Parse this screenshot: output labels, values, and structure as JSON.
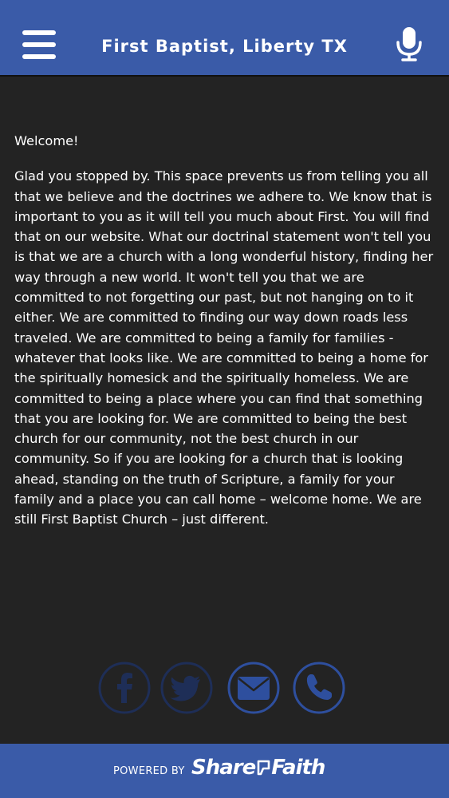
{
  "header": {
    "title": "First Baptist, Liberty TX",
    "menu_icon": "hamburger-menu-icon",
    "mic_icon": "microphone-icon"
  },
  "content": {
    "greeting": "Welcome!",
    "body": "Glad you stopped by. This space prevents us from telling you all that we believe and the doctrines we adhere to.  We know that is important to you as it will tell you much about First. You will find that on our website. What our doctrinal statement won't tell you is that we are a church with a long wonderful history, finding her way through a new world.  It won't tell you that we are committed to not forgetting our past, but not hanging on to it either. We are committed to finding our way down roads less traveled. We are committed to being a family for families - whatever that looks like. We are committed to being a home for the spiritually homesick and the spiritually homeless. We are committed to being a place where you can find that something that you are looking for. We are committed to being the best church for our community, not the best church in our community. So if you are looking for a church that is looking ahead, standing on the truth of Scripture, a family for your family and a place you can call home – welcome home. We are still First Baptist Church – just different."
  },
  "social": [
    {
      "icon": "facebook-icon",
      "state": "faded"
    },
    {
      "icon": "twitter-icon",
      "state": "faded"
    },
    {
      "icon": "email-icon",
      "state": "active"
    },
    {
      "icon": "phone-icon",
      "state": "active"
    }
  ],
  "footer": {
    "powered_label": "POWERED BY",
    "brand_part1": "Share",
    "brand_part2": "Faith"
  },
  "colors": {
    "header_bg": "#3A5BA8",
    "body_bg": "#232323",
    "icon_active": "#2E4F9E",
    "icon_faded": "#1E2E57"
  }
}
